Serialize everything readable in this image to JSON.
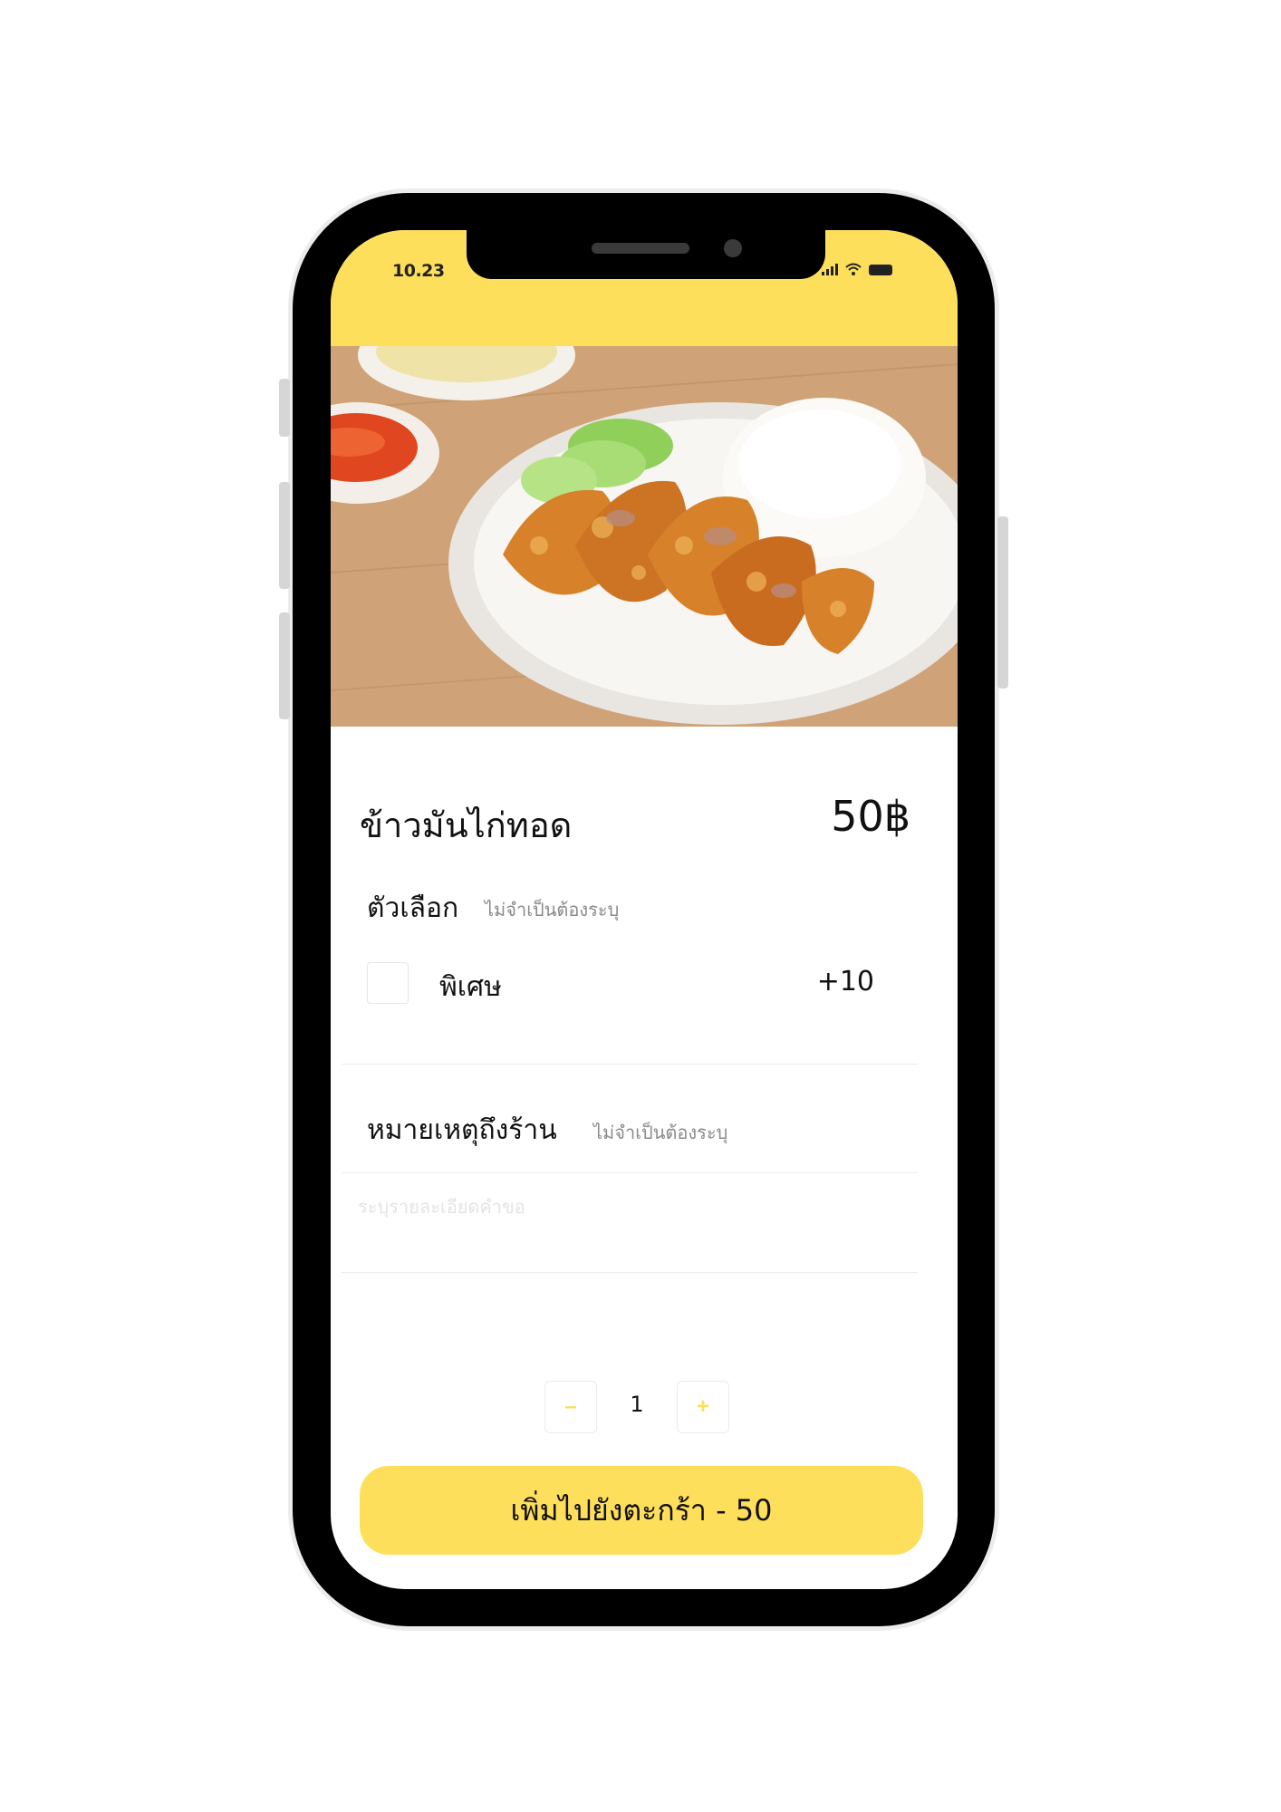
{
  "status_bar": {
    "time": "10.23",
    "icons": [
      "signal-icon",
      "wifi-icon",
      "battery-icon"
    ]
  },
  "photo": {
    "icon": "food-photo"
  },
  "dish": {
    "name": "ข้าวมันไก่ทอด",
    "price": "50฿"
  },
  "options": {
    "title": "ตัวเลือก",
    "hint": "ไม่จำเป็นต้องระบุ",
    "items": [
      {
        "label": "พิเศษ",
        "price": "+10",
        "checked": false
      }
    ]
  },
  "note": {
    "title": "หมายเหตุถึงร้าน",
    "hint": "ไม่จำเป็นต้องระบุ",
    "placeholder": "ระบุรายละเอียดคำขอ",
    "value": ""
  },
  "quantity": {
    "minus_label": "–",
    "plus_label": "+",
    "value": "1"
  },
  "cart_button": {
    "label": "เพิ่มไปยังตะกร้า - 50"
  },
  "colors": {
    "accent": "#fedf5b",
    "text": "#111111",
    "hint": "#8a8a8a",
    "divider": "#ececec"
  }
}
